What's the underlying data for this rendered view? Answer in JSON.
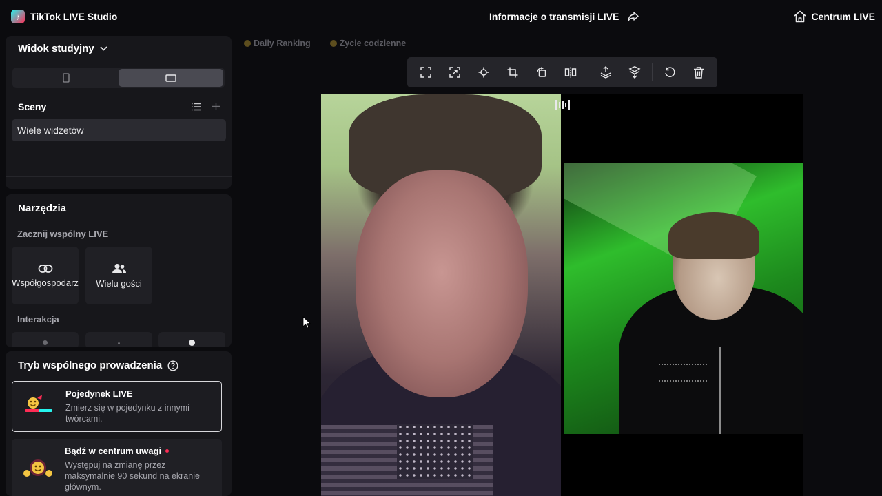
{
  "app": {
    "title": "TikTok LIVE Studio",
    "logo_glyph": "♪"
  },
  "header": {
    "stream_info": "Informacje o transmisji LIVE",
    "live_center": "Centrum LIVE"
  },
  "studio": {
    "view_label": "Widok studyjny",
    "orientation_selected": "landscape",
    "scenes_label": "Sceny",
    "scene_items": [
      "Wiele widżetów"
    ]
  },
  "tools": {
    "title": "Narzędzia",
    "group_cohost": "Zacznij wspólny LIVE",
    "cards": [
      "Współgospodarz",
      "Wielu gości"
    ],
    "group_interaction": "Interakcja"
  },
  "cohost_mode": {
    "title": "Tryb wspólnego prowadzenia",
    "options": [
      {
        "title": "Pojedynek LIVE",
        "desc": "Zmierz się w pojedynku z innymi twórcami."
      },
      {
        "title": "Bądź w centrum uwagi",
        "desc": "Występuj na zmianę przez maksymalnie 90 sekund na ekranie głównym."
      }
    ]
  },
  "scene_tags": [
    "Daily Ranking",
    "Życie codzienne"
  ],
  "toolbar": {
    "icons": [
      "fullscreen-icon",
      "fit-to-screen-icon",
      "center-icon",
      "crop-icon",
      "rotate-icon",
      "flip-horizontal-icon",
      "bring-forward-icon",
      "send-backward-icon",
      "reset-icon",
      "delete-icon"
    ]
  },
  "colors": {
    "accent_pink": "#fe2c55",
    "accent_cyan": "#25f4ee",
    "panel_bg": "#17171b",
    "page_bg": "#0b0b0e"
  }
}
